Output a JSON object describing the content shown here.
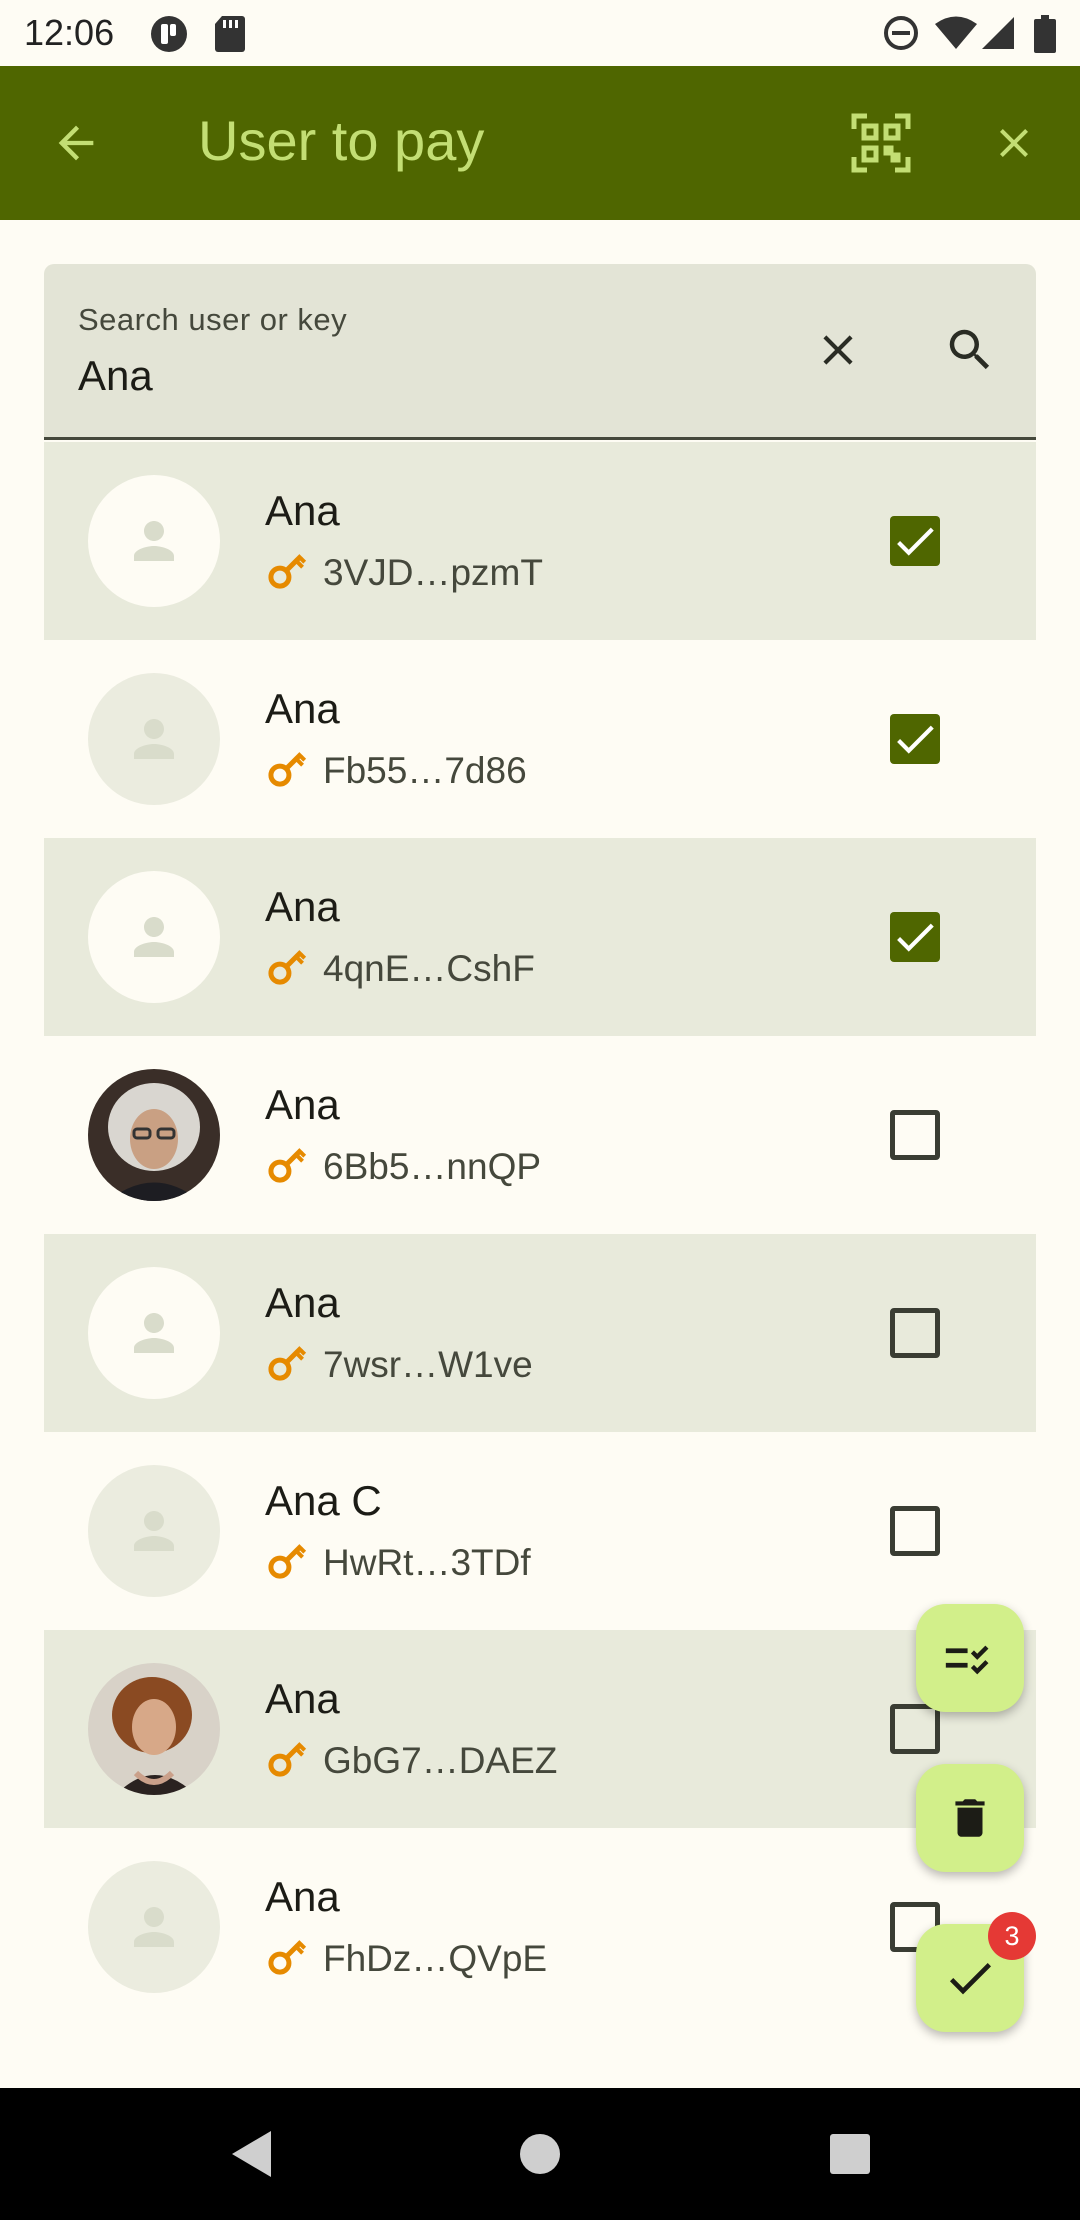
{
  "status_bar": {
    "time": "12:06",
    "left_icons": [
      "app-notification-icon",
      "sd-card-icon"
    ],
    "right_icons": [
      "do-not-disturb-icon",
      "wifi-icon",
      "cellular-signal-icon",
      "battery-icon"
    ]
  },
  "app_bar": {
    "title": "User to pay",
    "back_icon": "arrow-back-icon",
    "qr_icon": "qr-scanner-icon",
    "close_icon": "close-icon"
  },
  "search": {
    "label": "Search user or key",
    "value": "Ana",
    "clear_icon": "close-icon",
    "search_icon": "search-icon"
  },
  "users": [
    {
      "name": "Ana",
      "key": "3VJD…pzmT",
      "checked": true,
      "avatar": "placeholder"
    },
    {
      "name": "Ana",
      "key": "Fb55…7d86",
      "checked": true,
      "avatar": "placeholder"
    },
    {
      "name": "Ana",
      "key": "4qnE…CshF",
      "checked": true,
      "avatar": "placeholder"
    },
    {
      "name": "Ana",
      "key": "6Bb5…nnQP",
      "checked": false,
      "avatar": "photo-1"
    },
    {
      "name": "Ana",
      "key": "7wsr…W1ve",
      "checked": false,
      "avatar": "placeholder"
    },
    {
      "name": "Ana C",
      "key": "HwRt…3TDf",
      "checked": false,
      "avatar": "placeholder"
    },
    {
      "name": "Ana",
      "key": "GbG7…DAEZ",
      "checked": false,
      "avatar": "photo-2"
    },
    {
      "name": "Ana",
      "key": "FhDz…QVpE",
      "checked": false,
      "avatar": "placeholder"
    }
  ],
  "fabs": {
    "select_all_icon": "checklist-icon",
    "delete_icon": "delete-icon",
    "confirm_icon": "check-icon",
    "selected_count": "3"
  },
  "colors": {
    "primary": "#4f6600",
    "on_primary_title": "#c3de74",
    "fab": "#d2ef8a",
    "row_shade": "#e8eadb",
    "key_icon": "#e68a00",
    "badge": "#e53935"
  },
  "nav_bar": {
    "back_icon": "nav-back-icon",
    "home_icon": "nav-home-icon",
    "recents_icon": "nav-recents-icon"
  }
}
